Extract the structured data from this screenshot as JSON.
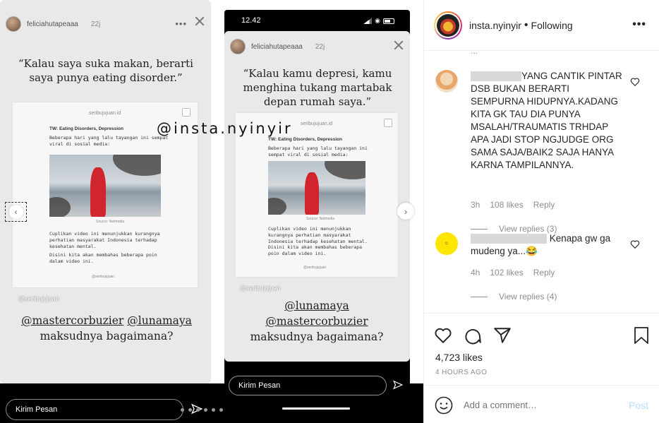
{
  "story_left": {
    "username": "feliciahutapeaaa",
    "time": "22j",
    "quote": "“Kalau saya suka makan, berarti saya punya eating disorder.”",
    "card_logo": "seribujujuan.id",
    "card_tw": "TW: Eating Disorders, Depression",
    "card_intro": "Beberapa hari yang lalu tayangan ini sempat viral di sosial media:",
    "card_source": "Source: Netmedia",
    "card_body1": "Cuplikan video ini menunjukkan kurangnya perhatian masyarakat Indonesia terhadap kesehatan mental.",
    "card_body2": "Disini kita akan membahas beberapa poin dalam video ini.",
    "card_handle": "@seribujujuan",
    "watermark": "@insta.nyinyir",
    "seribu": "@seribujujuan",
    "mention1": "@mastercorbuzier",
    "mention2": "@lunamaya",
    "caption": "maksudnya bagaimana?",
    "reply_placeholder": "Kirim Pesan"
  },
  "story_right": {
    "status_time": "12.42",
    "username": "feliciahutapeaaa",
    "time": "22j",
    "quote": "“Kalau kamu depresi, kamu menghina tukang martabak depan rumah saya.”",
    "card_logo": "seribujujuan.id",
    "card_tw": "TW: Eating Disorders, Depression",
    "card_intro": "Beberapa hari yang lalu tayangan ini sempat viral di sosial media:",
    "card_source": "Source: Netmedia",
    "card_body1": "Cuplikan video ini menunjukkan kurangnya perhatian masyarakat Indonesia terhadap kesehatan mental.",
    "card_body2": "Disini kita akan membahas beberapa poin dalam video ini.",
    "card_handle": "@seribujujuan",
    "seribu": "@seribujujuan",
    "mention1": "@lunamaya",
    "mention2": "@mastercorbuzier",
    "caption": "maksudnya bagaimana?",
    "reply_placeholder": "Kirim Pesan"
  },
  "panel": {
    "account": "insta.nyinyir",
    "separator": "•",
    "following": "Following",
    "more": "•••",
    "comments": [
      {
        "text": "YANG CANTIK PINTAR DSB BUKAN BERARTI SEMPURNA HIDUPNYA.KADANG KITA GK TAU DIA PUNYA MSALAH/TRAUMATIS TRHDAP APA JADI STOP NGJUDGE ORG SAMA SAJA/BAIK2 SAJA HANYA KARNA TAMPILANNYA.",
        "time": "3h",
        "likes": "108 likes",
        "reply": "Reply",
        "view_replies": "View replies (3)"
      },
      {
        "text": "Kenapa gw ga mudeng ya...😂",
        "time": "4h",
        "likes": "102 likes",
        "reply": "Reply",
        "view_replies": "View replies (4)"
      }
    ],
    "likes_total": "4,723 likes",
    "posted_ago": "4 HOURS AGO",
    "add_comment_placeholder": "Add a comment…",
    "post_label": "Post"
  }
}
